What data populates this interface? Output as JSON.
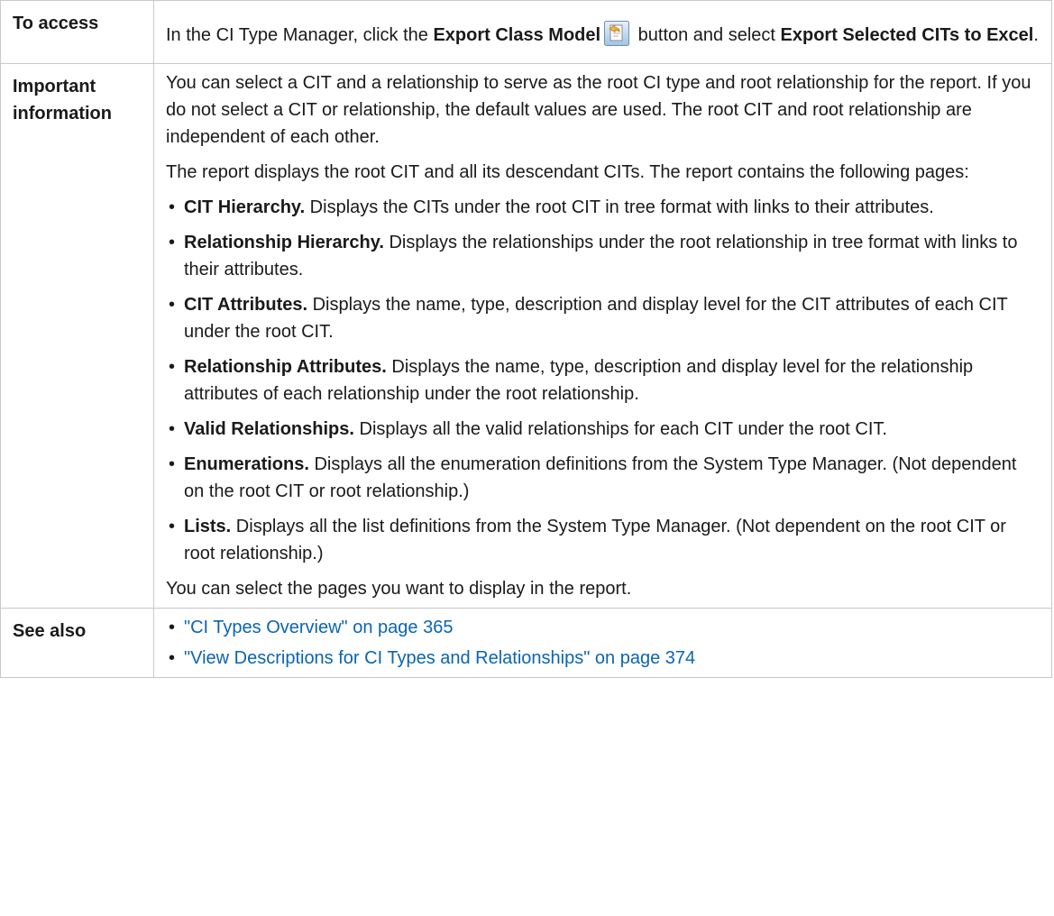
{
  "rows": {
    "access": {
      "label": "To access",
      "t1": "In the CI Type Manager, click the ",
      "b1": "Export Class Model",
      "t2": " button and select ",
      "b2": "Export Selected CITs to Excel",
      "t3": ".",
      "icon": "export-class-model-icon"
    },
    "important": {
      "label_line1": "Important",
      "label_line2": "information",
      "p1": "You can select a CIT and a relationship to serve as the root CI type and root relationship for the report. If you do not select a CIT or relationship, the default values are used. The root CIT and root relationship are independent of each other.",
      "p2": "The report displays the root CIT and all its descendant CITs. The report contains the following pages:",
      "items": [
        {
          "title": "CIT Hierarchy.",
          "text": " Displays the CITs under the root CIT in tree format with links to their attributes."
        },
        {
          "title": "Relationship Hierarchy.",
          "text": " Displays the relationships under the root relationship in tree format with links to their attributes."
        },
        {
          "title": "CIT Attributes.",
          "text": " Displays the name, type, description and display level for the CIT attributes of each CIT under the root CIT."
        },
        {
          "title": "Relationship Attributes.",
          "text": " Displays the name, type, description and display level for the relationship attributes of each relationship under the root relationship."
        },
        {
          "title": "Valid Relationships.",
          "text": " Displays all the valid relationships for each CIT under the root CIT."
        },
        {
          "title": "Enumerations.",
          "text": " Displays all the enumeration definitions from the System Type Manager. (Not dependent on the root CIT or root relationship.)"
        },
        {
          "title": "Lists.",
          "text": " Displays all the list definitions from the System Type Manager. (Not dependent on the root CIT or root relationship.)"
        }
      ],
      "p3": "You can select the pages you want to display in the report."
    },
    "see_also": {
      "label": "See also",
      "links": [
        "\"CI Types Overview\" on page 365",
        "\"View Descriptions for CI Types and Relationships\" on page 374"
      ]
    }
  },
  "colors": {
    "link": "#0b64b3",
    "border": "#c8c8c8",
    "text": "#1a1a1a"
  }
}
